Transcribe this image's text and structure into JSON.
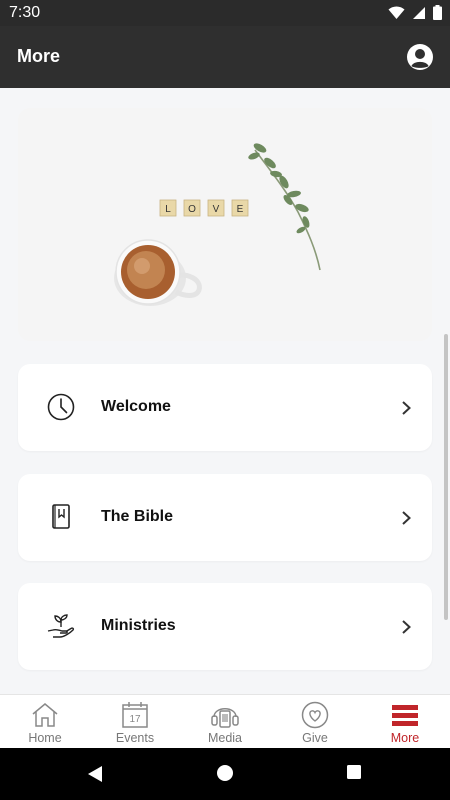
{
  "status_bar": {
    "time": "7:30"
  },
  "header": {
    "title": "More"
  },
  "hero": {
    "tiles": [
      "L",
      "O",
      "V",
      "E"
    ]
  },
  "menu_items": [
    {
      "label": "Welcome",
      "icon": "clock-icon"
    },
    {
      "label": "The Bible",
      "icon": "bible-icon"
    },
    {
      "label": "Ministries",
      "icon": "hand-plant-icon"
    }
  ],
  "bottom_nav": [
    {
      "label": "Home",
      "icon": "home-icon",
      "active": false
    },
    {
      "label": "Events",
      "icon": "calendar-icon",
      "date": "17",
      "active": false
    },
    {
      "label": "Media",
      "icon": "media-player-icon",
      "active": false
    },
    {
      "label": "Give",
      "icon": "heart-icon",
      "active": false
    },
    {
      "label": "More",
      "icon": "menu-icon",
      "active": true
    }
  ],
  "colors": {
    "accent": "#c0252a",
    "header_bg": "#2f2f2f",
    "page_bg": "#f5f6f8"
  }
}
